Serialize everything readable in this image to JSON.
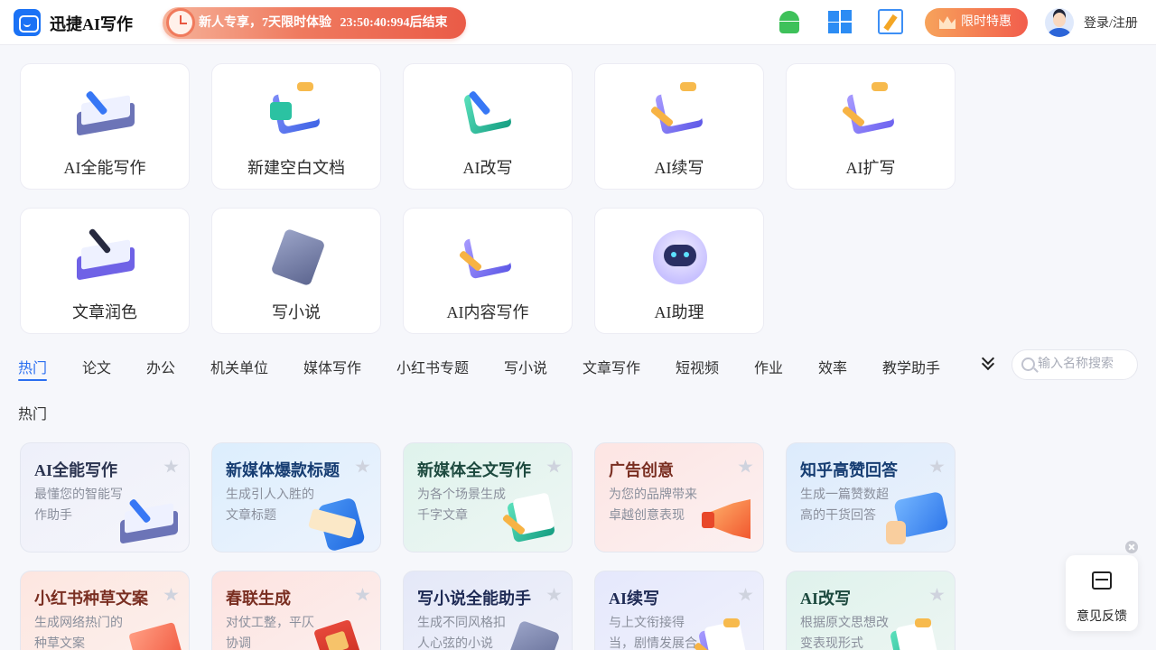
{
  "header": {
    "app_name": "迅捷AI写作",
    "promo_text": "新人专享，7天限时体验",
    "countdown": "23:50:40:994后结束",
    "vip_label": "限时特惠",
    "login_label": "登录/注册"
  },
  "tools": [
    {
      "label": "AI全能写作",
      "icon": "book-pen-icon"
    },
    {
      "label": "新建空白文档",
      "icon": "new-document-icon"
    },
    {
      "label": "AI改写",
      "icon": "rewrite-icon"
    },
    {
      "label": "AI续写",
      "icon": "continue-writing-icon"
    },
    {
      "label": "AI扩写",
      "icon": "expand-writing-icon"
    },
    {
      "label": "文章润色",
      "icon": "polish-icon"
    },
    {
      "label": "写小说",
      "icon": "notebook-icon"
    },
    {
      "label": "AI内容写作",
      "icon": "content-writing-icon"
    },
    {
      "label": "AI助理",
      "icon": "robot-icon"
    }
  ],
  "categories": [
    "热门",
    "论文",
    "办公",
    "机关单位",
    "媒体写作",
    "小红书专题",
    "写小说",
    "文章写作",
    "短视频",
    "作业",
    "效率",
    "教学助手"
  ],
  "active_category": "热门",
  "search": {
    "placeholder": "输入名称搜索"
  },
  "section_title": "热门",
  "templates": [
    {
      "title": "AI全能写作",
      "desc": "最懂您的智能写作助手"
    },
    {
      "title": "新媒体爆款标题",
      "desc": "生成引人入胜的文章标题"
    },
    {
      "title": "新媒体全文写作",
      "desc": "为各个场景生成千字文章"
    },
    {
      "title": "广告创意",
      "desc": "为您的品牌带来卓越创意表现"
    },
    {
      "title": "知乎高赞回答",
      "desc": "生成一篇赞数超高的干货回答"
    },
    {
      "title": "小红书种草文案",
      "desc": "生成网络热门的种草文案"
    },
    {
      "title": "春联生成",
      "desc": "对仗工整，平仄协调"
    },
    {
      "title": "写小说全能助手",
      "desc": "生成不同风格扣人心弦的小说"
    },
    {
      "title": "AI续写",
      "desc": "与上文衔接得当，剧情发展合"
    },
    {
      "title": "AI改写",
      "desc": "根据原文思想改变表现形式"
    }
  ],
  "feedback": {
    "label": "意见反馈"
  },
  "colors": {
    "accent": "#2b6ff0",
    "promo": "#ef7a5f",
    "vip": "#f25d4c"
  }
}
